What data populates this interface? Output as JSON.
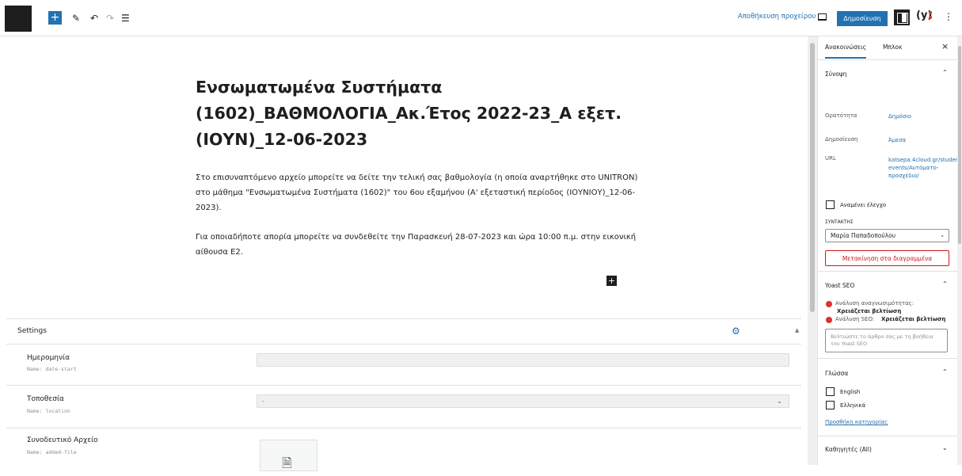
{
  "toolbar": {
    "logo_icon": "wordpress-icon",
    "add_icon": "plus-icon",
    "tools_icon": "pencil-icon",
    "undo_icon": "undo-icon",
    "redo_icon": "redo-icon",
    "outline_icon": "list-view-icon",
    "save_draft_label": "Αποθήκευση προχείρου",
    "preview_icon": "preview-icon",
    "publish_label": "Δημοσίευση",
    "settings_icon": "settings-panel-icon",
    "yoast_icon": "yoast-icon",
    "more_icon": "kebab-menu-icon"
  },
  "post": {
    "title": "Ενσωματωμένα Συστήματα (1602)_ΒΑΘΜΟΛΟΓΙΑ_Ακ.Έτος 2022-23_Α εξετ. (ΙΟΥΝ)_12-06-2023",
    "paragraph1": "Στο επισυναπτόμενο αρχείο μπορείτε να δείτε την τελική σας βαθμολογία (η οποία αναρτήθηκε στο UNITRON) στο μάθημα \"Ενσωματωμένα Συστήματα (1602)\" του 6ου εξαμήνου (Α' εξεταστική περίοδος (ΙΟΥΝΙΟΥ)_12-06-2023).",
    "paragraph2": "Για οποιαδήποτε απορία μπορείτε να συνδεθείτε την Παρασκευή 28-07-2023 και ώρα 10:00 π.μ. στην εικονική αίθουσα Ε2.",
    "inserter_icon": "plus-icon"
  },
  "metabox": {
    "title": "Settings",
    "gear_icon": "gear-icon",
    "fields": [
      {
        "label": "Ημερομηνία",
        "name": "Name: date-start",
        "value": ""
      },
      {
        "label": "Τοποθεσία",
        "name": "Name: location",
        "value": "-"
      },
      {
        "label": "Συνοδευτικό Αρχείο",
        "name": "Name: added-file",
        "icon": "file-icon"
      }
    ]
  },
  "sidebar": {
    "tabs": [
      "Ανακοινώσεις",
      "Μπλοκ"
    ],
    "close_icon": "close-icon",
    "summary": {
      "title": "Σύνοψη",
      "visibility_label": "Ορατότητα",
      "visibility_value": "Δημόσιο",
      "publish_label": "Δημοσίευση",
      "publish_value": "Άμεσα",
      "url_label": "URL",
      "url_value": "katsepa.4cloud.gr/student-events/Αυτόματο-προσχέδιο/",
      "pending_review_label": "Αναμένει έλεγχο",
      "author_label": "ΣΥΝΤΑΚΤΗΣ",
      "author_value": "Μαρία Παπαδοπούλου",
      "trash_label": "Μετακίνηση στα διαγραμμένα"
    },
    "yoast": {
      "title": "Yoast SEO",
      "readability_label": "Ανάλυση αναγνωσιμότητας:",
      "readability_value": "Χρειάζεται βελτίωση",
      "seo_label": "Ανάλυση SEO:",
      "seo_value": "Χρειάζεται βελτίωση",
      "improve_text": "Βελτιώστε το άρθρο σας με τη βοήθεια του Yoast SEO"
    },
    "language": {
      "title": "Γλώσσα",
      "options": [
        "English",
        "Ελληνικά"
      ],
      "add_category": "Προσθήκη κατηγορίας"
    },
    "teachers": {
      "title": "Καθηγητές (All)"
    }
  }
}
